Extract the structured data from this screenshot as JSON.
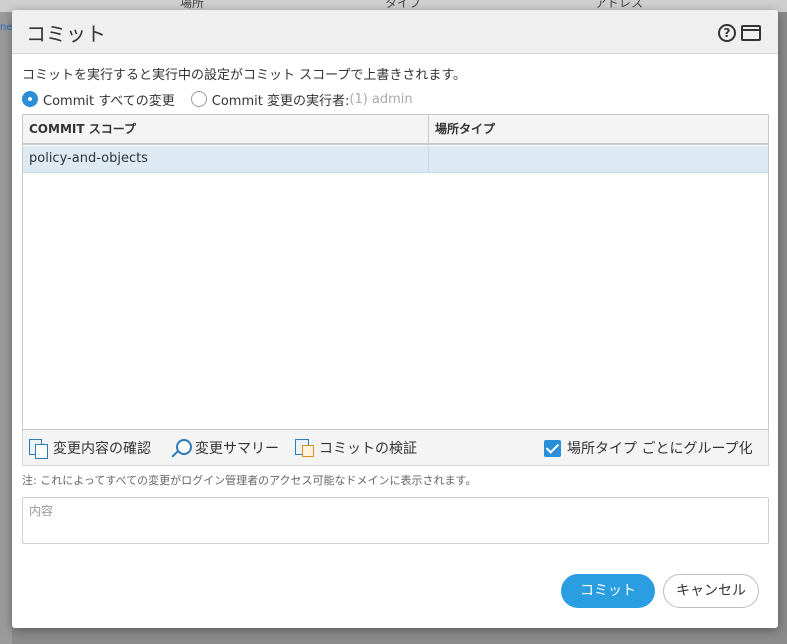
{
  "background": {
    "col1": "場所",
    "col2": "タイプ",
    "col3": "アドレス",
    "left_text": "ner"
  },
  "dialog": {
    "title": "コミット",
    "help_icon": "question-circle-icon",
    "window_icon": "maximize-window-icon",
    "description": "コミットを実行すると実行中の設定がコミット スコープで上書きされます。",
    "radio_options": [
      {
        "label": "Commit すべての変更",
        "checked": true
      },
      {
        "label": "Commit 変更の実行者:",
        "suffix": "(1) admin",
        "checked": false
      }
    ],
    "table": {
      "columns": [
        "COMMIT スコープ",
        "場所タイプ"
      ],
      "rows": [
        {
          "scope": "policy-and-objects",
          "location_type": ""
        }
      ]
    },
    "toolbar": {
      "preview_changes": "変更内容の確認",
      "change_summary": "変更サマリー",
      "validate_commit": "コミットの検証",
      "group_by_location": "場所タイプ ごとにグループ化",
      "group_by_location_checked": true
    },
    "note": "注: これによってすべての変更がログイン管理者のアクセス可能なドメインに表示されます。",
    "description_field": {
      "placeholder": "内容",
      "value": ""
    },
    "buttons": {
      "commit": "コミット",
      "cancel": "キャンセル"
    }
  },
  "colors": {
    "accent": "#2a9ee0",
    "selected_row": "#dde9f3",
    "title_bar": "#efefef"
  }
}
